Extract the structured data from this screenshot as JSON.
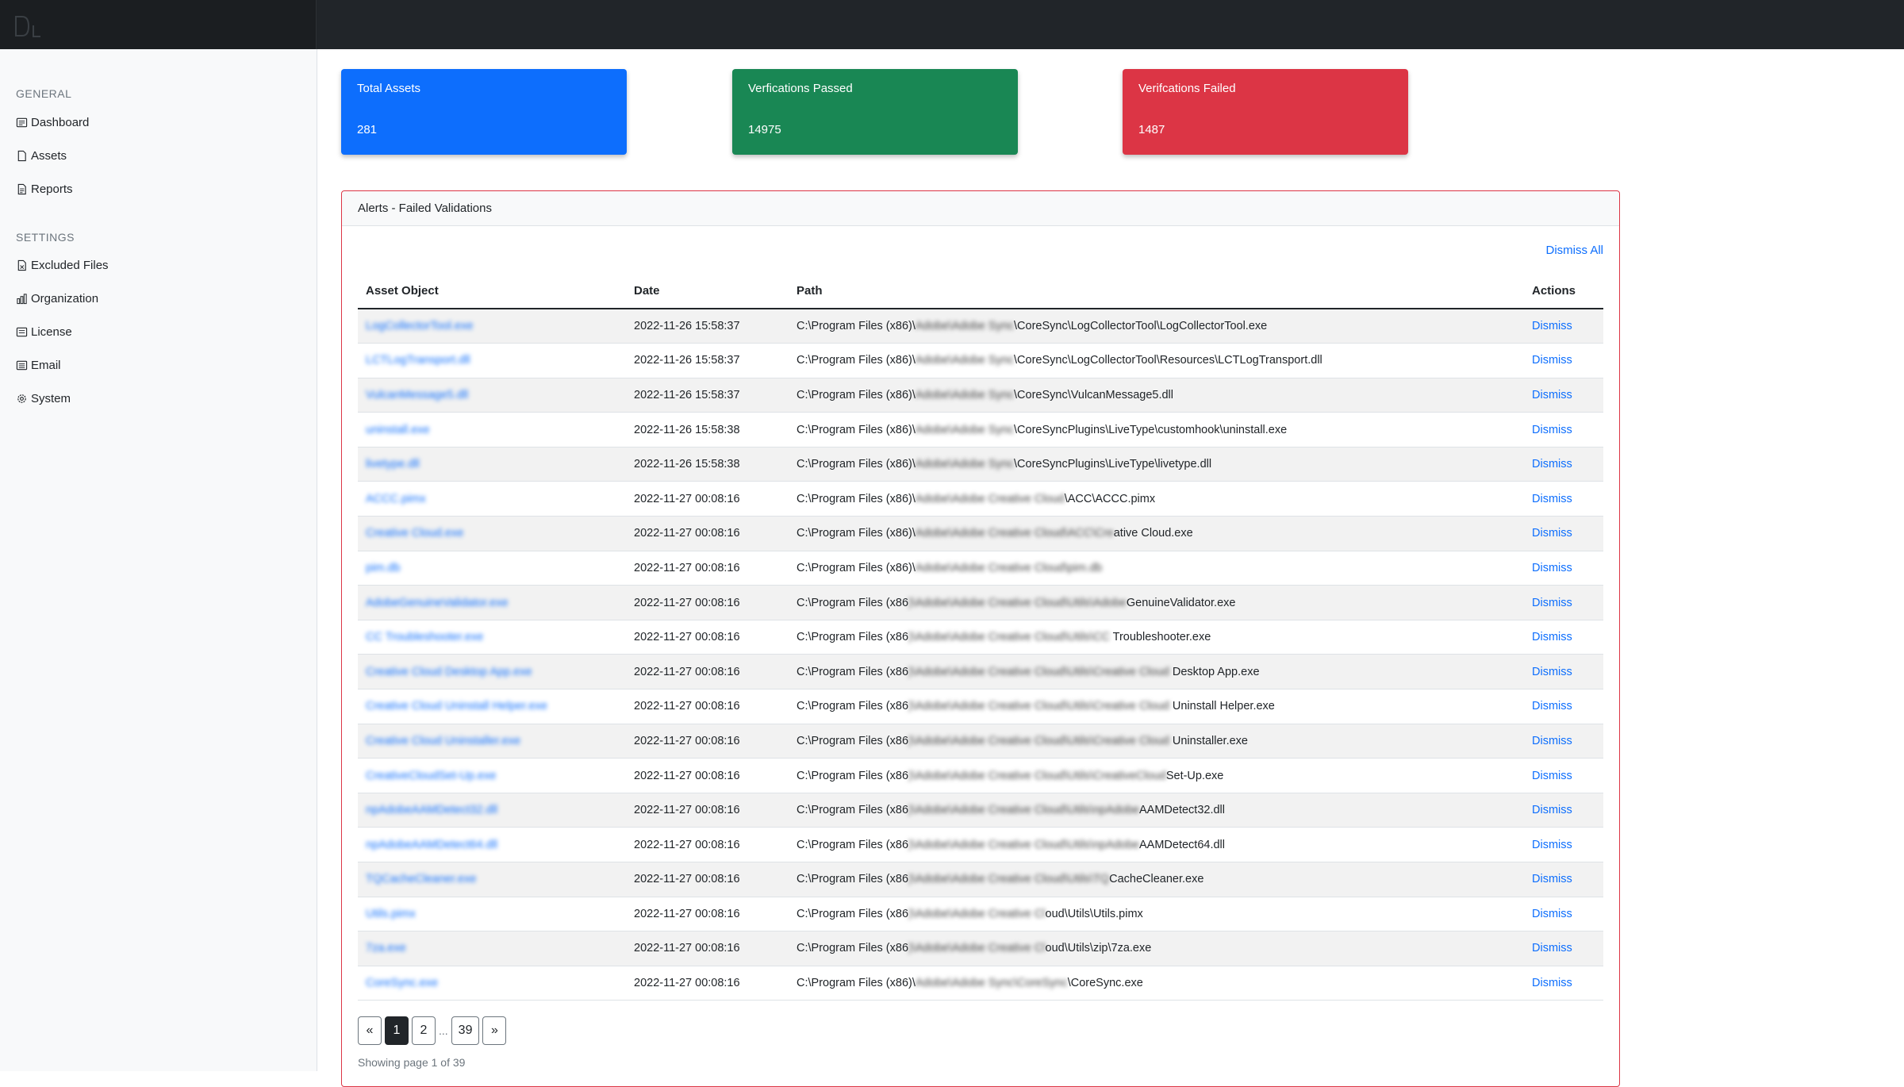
{
  "brand": {
    "logo_text": "DL"
  },
  "sidebar": {
    "general_heading": "GENERAL",
    "settings_heading": "SETTINGS",
    "items": [
      {
        "label": "Dashboard"
      },
      {
        "label": "Assets"
      },
      {
        "label": "Reports"
      },
      {
        "label": "Excluded Files"
      },
      {
        "label": "Organization"
      },
      {
        "label": "License"
      },
      {
        "label": "Email"
      },
      {
        "label": "System"
      }
    ]
  },
  "stats": [
    {
      "label": "Total Assets",
      "value": "281",
      "color": "#0d6efd"
    },
    {
      "label": "Verfications Passed",
      "value": "14975",
      "color": "#198754"
    },
    {
      "label": "Verifcations Failed",
      "value": "1487",
      "color": "#dc3545"
    }
  ],
  "alerts": {
    "title": "Alerts - Failed Validations",
    "dismiss_all": "Dismiss All",
    "columns": [
      "Asset Object",
      "Date",
      "Path",
      "Actions"
    ],
    "action_label": "Dismiss",
    "rows": [
      {
        "asset": "LogCollectorTool.exe",
        "date": "2022-11-26 15:58:37",
        "path_prefix": "C:\\Program Files (x86)\\",
        "path_hidden": "Adobe\\Adobe Sync",
        "path_suffix": "\\CoreSync\\LogCollectorTool\\LogCollectorTool.exe"
      },
      {
        "asset": "LCTLogTransport.dll",
        "date": "2022-11-26 15:58:37",
        "path_prefix": "C:\\Program Files (x86)\\",
        "path_hidden": "Adobe\\Adobe Sync",
        "path_suffix": "\\CoreSync\\LogCollectorTool\\Resources\\LCTLogTransport.dll"
      },
      {
        "asset": "VulcanMessage5.dll",
        "date": "2022-11-26 15:58:37",
        "path_prefix": "C:\\Program Files (x86)\\",
        "path_hidden": "Adobe\\Adobe Sync",
        "path_suffix": "\\CoreSync\\VulcanMessage5.dll"
      },
      {
        "asset": "uninstall.exe",
        "date": "2022-11-26 15:58:38",
        "path_prefix": "C:\\Program Files (x86)\\",
        "path_hidden": "Adobe\\Adobe Sync",
        "path_suffix": "\\CoreSyncPlugins\\LiveType\\customhook\\uninstall.exe"
      },
      {
        "asset": "livetype.dll",
        "date": "2022-11-26 15:58:38",
        "path_prefix": "C:\\Program Files (x86)\\",
        "path_hidden": "Adobe\\Adobe Sync",
        "path_suffix": "\\CoreSyncPlugins\\LiveType\\livetype.dll"
      },
      {
        "asset": "ACCC.pimx",
        "date": "2022-11-27 00:08:16",
        "path_prefix": "C:\\Program Files (x86)\\",
        "path_hidden": "Adobe\\Adobe Creative Cloud",
        "path_suffix": "\\ACC\\ACCC.pimx"
      },
      {
        "asset": "Creative Cloud.exe",
        "date": "2022-11-27 00:08:16",
        "path_prefix": "C:\\Program Files (x86)\\",
        "path_hidden": "Adobe\\Adobe Creative Cloud\\ACC\\Cre",
        "path_suffix": "ative Cloud.exe"
      },
      {
        "asset": "pim.db",
        "date": "2022-11-27 00:08:16",
        "path_prefix": "C:\\Program Files (x86)\\",
        "path_hidden": "Adobe\\Adobe Creative Cloud\\pim.db",
        "path_suffix": ""
      },
      {
        "asset": "AdobeGenuineValidator.exe",
        "date": "2022-11-27 00:08:16",
        "path_prefix": "C:\\Program Files (x86",
        "path_hidden": ")\\Adobe\\Adobe Creative Cloud\\Utils\\Adobe",
        "path_suffix": "GenuineValidator.exe"
      },
      {
        "asset": "CC Troubleshooter.exe",
        "date": "2022-11-27 00:08:16",
        "path_prefix": "C:\\Program Files (x86",
        "path_hidden": ")\\Adobe\\Adobe Creative Cloud\\Utils\\CC",
        "path_suffix": " Troubleshooter.exe"
      },
      {
        "asset": "Creative Cloud Desktop App.exe",
        "date": "2022-11-27 00:08:16",
        "path_prefix": "C:\\Program Files (x86",
        "path_hidden": ")\\Adobe\\Adobe Creative Cloud\\Utils\\Creative Cloud",
        "path_suffix": " Desktop App.exe"
      },
      {
        "asset": "Creative Cloud Uninstall Helper.exe",
        "date": "2022-11-27 00:08:16",
        "path_prefix": "C:\\Program Files (x86",
        "path_hidden": ")\\Adobe\\Adobe Creative Cloud\\Utils\\Creative Cloud",
        "path_suffix": " Uninstall Helper.exe"
      },
      {
        "asset": "Creative Cloud Uninstaller.exe",
        "date": "2022-11-27 00:08:16",
        "path_prefix": "C:\\Program Files (x86",
        "path_hidden": ")\\Adobe\\Adobe Creative Cloud\\Utils\\Creative Cloud",
        "path_suffix": " Uninstaller.exe"
      },
      {
        "asset": "CreativeCloudSet-Up.exe",
        "date": "2022-11-27 00:08:16",
        "path_prefix": "C:\\Program Files (x86",
        "path_hidden": ")\\Adobe\\Adobe Creative Cloud\\Utils\\CreativeCloud",
        "path_suffix": "Set-Up.exe"
      },
      {
        "asset": "npAdobeAAMDetect32.dll",
        "date": "2022-11-27 00:08:16",
        "path_prefix": "C:\\Program Files (x86",
        "path_hidden": ")\\Adobe\\Adobe Creative Cloud\\Utils\\npAdobe",
        "path_suffix": "AAMDetect32.dll"
      },
      {
        "asset": "npAdobeAAMDetect64.dll",
        "date": "2022-11-27 00:08:16",
        "path_prefix": "C:\\Program Files (x86",
        "path_hidden": ")\\Adobe\\Adobe Creative Cloud\\Utils\\npAdobe",
        "path_suffix": "AAMDetect64.dll"
      },
      {
        "asset": "TQCacheCleaner.exe",
        "date": "2022-11-27 00:08:16",
        "path_prefix": "C:\\Program Files (x86",
        "path_hidden": ")\\Adobe\\Adobe Creative Cloud\\Utils\\TQ",
        "path_suffix": "CacheCleaner.exe"
      },
      {
        "asset": "Utils.pimx",
        "date": "2022-11-27 00:08:16",
        "path_prefix": "C:\\Program Files (x86",
        "path_hidden": ")\\Adobe\\Adobe Creative Cl",
        "path_suffix": "oud\\Utils\\Utils.pimx"
      },
      {
        "asset": "7za.exe",
        "date": "2022-11-27 00:08:16",
        "path_prefix": "C:\\Program Files (x86",
        "path_hidden": ")\\Adobe\\Adobe Creative Cl",
        "path_suffix": "oud\\Utils\\zip\\7za.exe"
      },
      {
        "asset": "CoreSync.exe",
        "date": "2022-11-27 00:08:16",
        "path_prefix": "C:\\Program Files (x86)\\",
        "path_hidden": "Adobe\\Adobe Sync\\CoreSync",
        "path_suffix": "\\CoreSync.exe"
      }
    ]
  },
  "pagination": {
    "prev": "«",
    "pages": [
      "1",
      "2"
    ],
    "ellipsis": "...",
    "last": "39",
    "next": "»",
    "info": "Showing page 1 of 39"
  }
}
